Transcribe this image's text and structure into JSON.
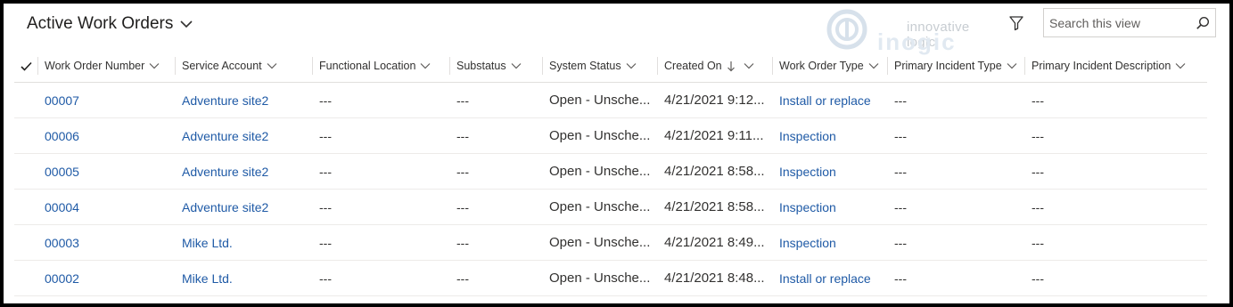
{
  "view": {
    "title": "Active Work Orders"
  },
  "logo": {
    "tagline": "innovative logic",
    "brand": "inogic"
  },
  "search": {
    "placeholder": "Search this view"
  },
  "columns": [
    {
      "key": "work_order_number",
      "label": "Work Order Number"
    },
    {
      "key": "service_account",
      "label": "Service Account"
    },
    {
      "key": "functional_location",
      "label": "Functional Location"
    },
    {
      "key": "substatus",
      "label": "Substatus"
    },
    {
      "key": "system_status",
      "label": "System Status"
    },
    {
      "key": "created_on",
      "label": "Created On",
      "sort": "descending"
    },
    {
      "key": "work_order_type",
      "label": "Work Order Type"
    },
    {
      "key": "primary_incident_type",
      "label": "Primary Incident Type"
    },
    {
      "key": "primary_incident_description",
      "label": "Primary Incident Description"
    }
  ],
  "rows": [
    {
      "work_order_number": "00007",
      "service_account": "Adventure site2",
      "functional_location": "---",
      "substatus": "---",
      "system_status": "Open - Unsche...",
      "created_on": "4/21/2021 9:12...",
      "work_order_type": "Install or replace",
      "primary_incident_type": "---",
      "primary_incident_description": "---"
    },
    {
      "work_order_number": "00006",
      "service_account": "Adventure site2",
      "functional_location": "---",
      "substatus": "---",
      "system_status": "Open - Unsche...",
      "created_on": "4/21/2021 9:11...",
      "work_order_type": "Inspection",
      "primary_incident_type": "---",
      "primary_incident_description": "---"
    },
    {
      "work_order_number": "00005",
      "service_account": "Adventure site2",
      "functional_location": "---",
      "substatus": "---",
      "system_status": "Open - Unsche...",
      "created_on": "4/21/2021 8:58...",
      "work_order_type": "Inspection",
      "primary_incident_type": "---",
      "primary_incident_description": "---"
    },
    {
      "work_order_number": "00004",
      "service_account": "Adventure site2",
      "functional_location": "---",
      "substatus": "---",
      "system_status": "Open - Unsche...",
      "created_on": "4/21/2021 8:58...",
      "work_order_type": "Inspection",
      "primary_incident_type": "---",
      "primary_incident_description": "---"
    },
    {
      "work_order_number": "00003",
      "service_account": "Mike Ltd.",
      "functional_location": "---",
      "substatus": "---",
      "system_status": "Open - Unsche...",
      "created_on": "4/21/2021 8:49...",
      "work_order_type": "Inspection",
      "primary_incident_type": "---",
      "primary_incident_description": "---"
    },
    {
      "work_order_number": "00002",
      "service_account": "Mike Ltd.",
      "functional_location": "---",
      "substatus": "---",
      "system_status": "Open - Unsche...",
      "created_on": "4/21/2021 8:48...",
      "work_order_type": "Install or replace",
      "primary_incident_type": "---",
      "primary_incident_description": "---"
    }
  ],
  "colors": {
    "link": "#1f5aa6",
    "text": "#323130",
    "border": "#e1dfdd"
  }
}
